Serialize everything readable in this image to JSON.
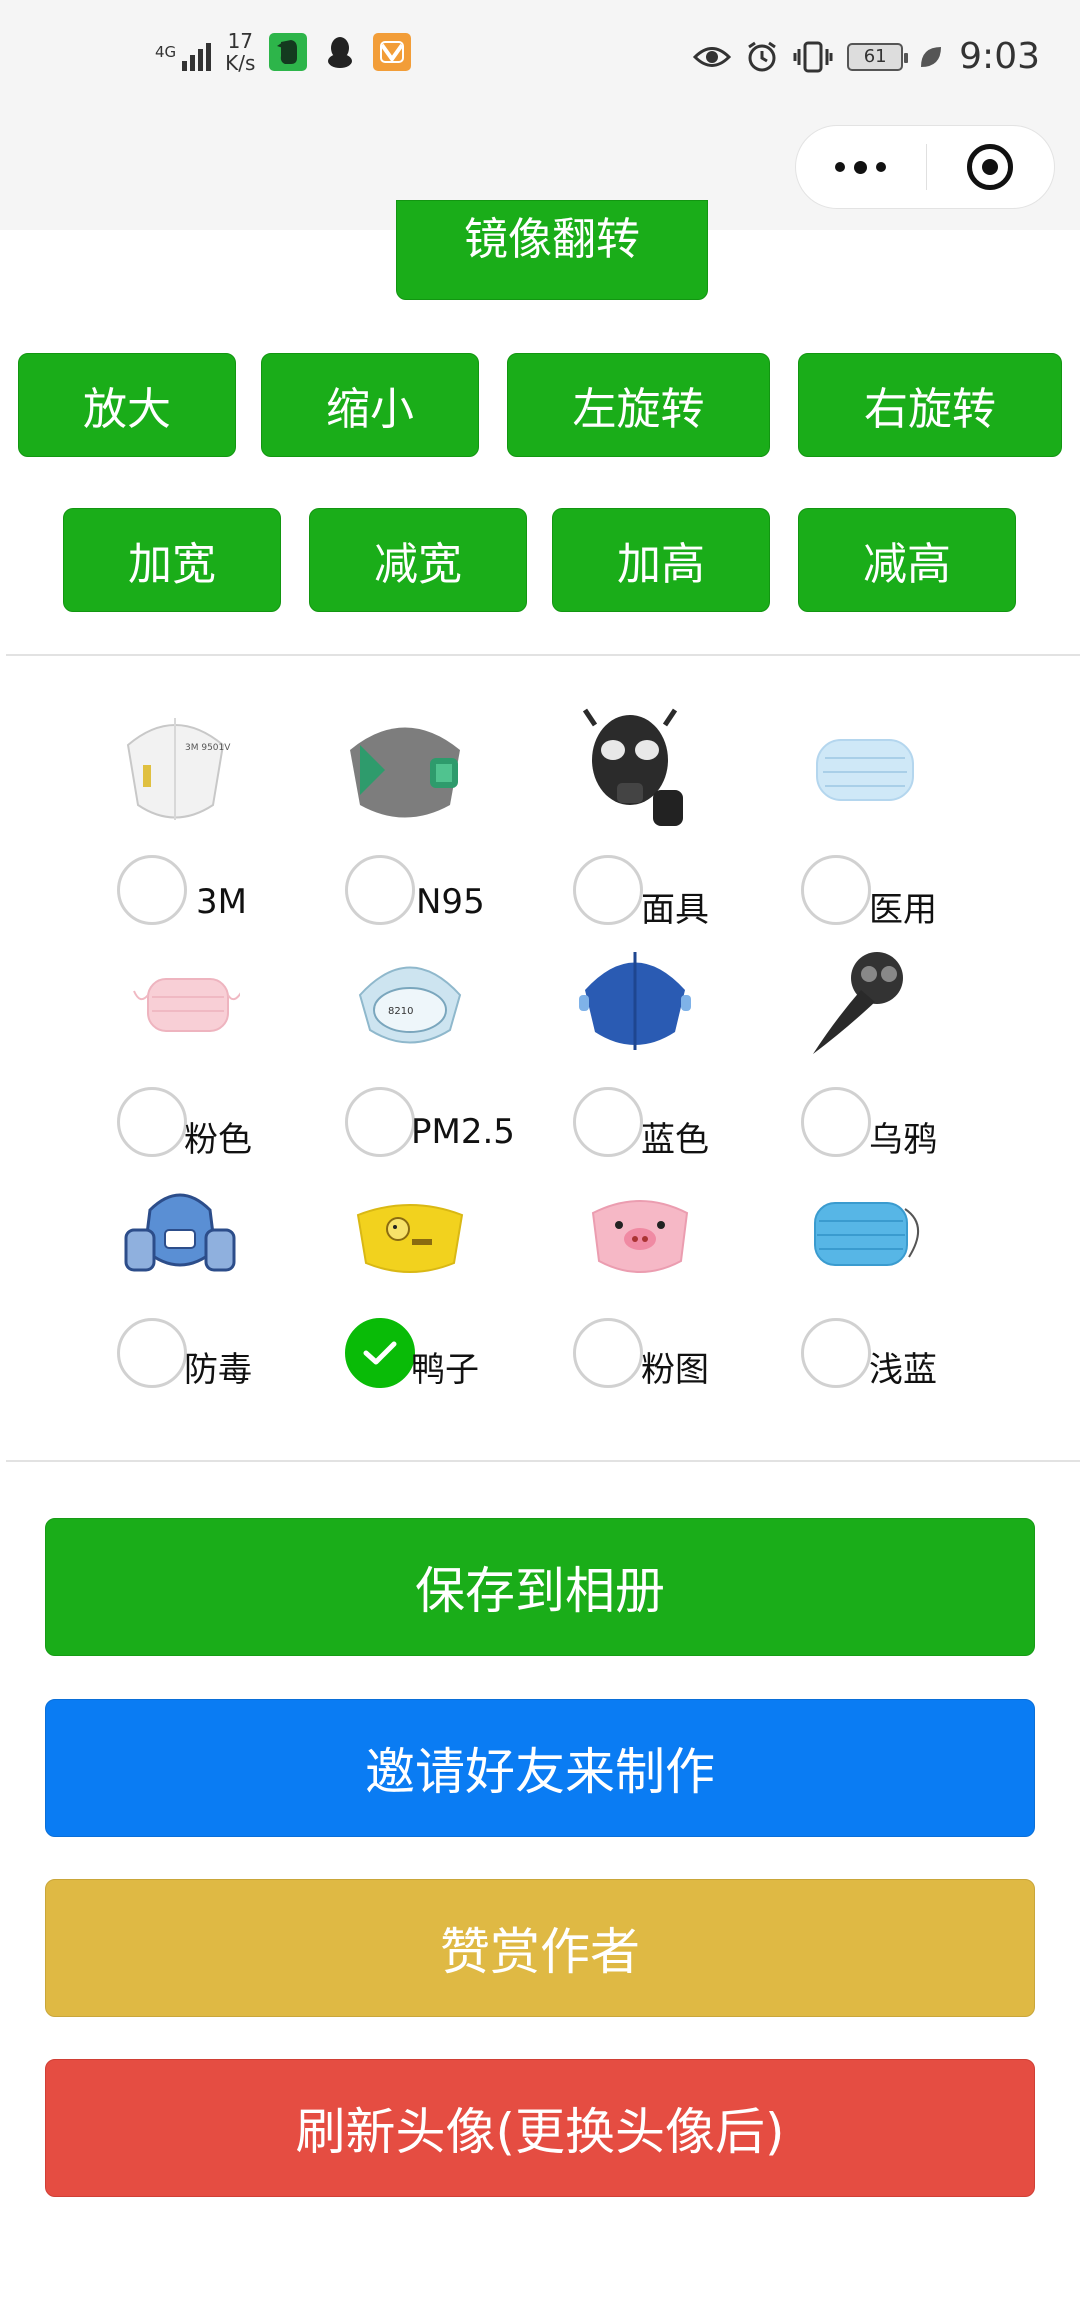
{
  "status_bar": {
    "network": "4G",
    "speed_value": "17",
    "speed_unit": "K/s",
    "battery": "61",
    "time": "9:03"
  },
  "top_button": {
    "mirror_label": "镜像翻转"
  },
  "transform_row1": [
    "放大",
    "缩小",
    "左旋转",
    "右旋转"
  ],
  "transform_row2": [
    "加宽",
    "减宽",
    "加高",
    "减高"
  ],
  "masks": [
    {
      "label": "3M",
      "selected": false
    },
    {
      "label": "N95",
      "selected": false
    },
    {
      "label": "面具",
      "selected": false
    },
    {
      "label": "医用",
      "selected": false
    },
    {
      "label": "粉色",
      "selected": false
    },
    {
      "label": "PM2.5",
      "selected": false
    },
    {
      "label": "蓝色",
      "selected": false
    },
    {
      "label": "乌鸦",
      "selected": false
    },
    {
      "label": "防毒",
      "selected": false
    },
    {
      "label": "鸭子",
      "selected": true
    },
    {
      "label": "粉图",
      "selected": false
    },
    {
      "label": "浅蓝",
      "selected": false
    }
  ],
  "actions": {
    "save": "保存到相册",
    "invite": "邀请好友来制作",
    "reward": "赞赏作者",
    "refresh": "刷新头像(更换头像后)"
  },
  "colors": {
    "green": "#1aad19",
    "blue": "#0a7cf3",
    "gold": "#dfb944",
    "red": "#e54d42",
    "check_green": "#09bb07"
  }
}
